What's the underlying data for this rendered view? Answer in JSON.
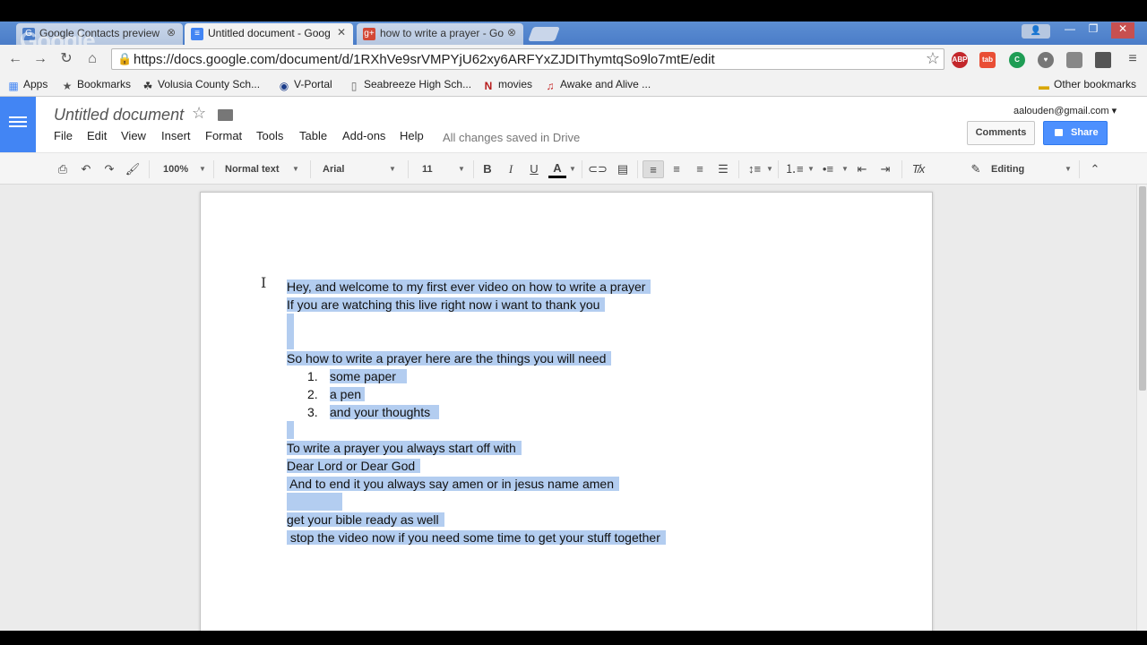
{
  "browser": {
    "tabs": [
      {
        "label": "Google Contacts preview",
        "favicon": "G"
      },
      {
        "label": "Untitled document - Goog",
        "favicon": "docs"
      },
      {
        "label": "how to write a prayer - Go",
        "favicon": "g+"
      }
    ],
    "url": "https://docs.google.com/document/d/1RXhVe9srVMPYjU62xy6ARFYxZJDIThymtqSo9lo7mtE/edit",
    "watermark": "Google",
    "extensions": [
      {
        "label": "ABP",
        "color": "#c3272b"
      },
      {
        "label": "tab",
        "color": "#e94e35"
      },
      {
        "label": "C",
        "color": "#1f9d55"
      },
      {
        "label": "♥",
        "color": "#777777"
      }
    ]
  },
  "bookmarks": {
    "apps": "Apps",
    "items": [
      "Bookmarks",
      "Volusia County Sch...",
      "V-Portal",
      "Seabreeze High Sch...",
      "movies",
      "Awake and Alive ..."
    ],
    "other": "Other bookmarks"
  },
  "docs": {
    "title": "Untitled document",
    "menu": [
      "File",
      "Edit",
      "View",
      "Insert",
      "Format",
      "Tools",
      "Table",
      "Add-ons",
      "Help"
    ],
    "saved_status": "All changes saved in Drive",
    "account": "aalouden@gmail.com",
    "comments_label": "Comments",
    "share_label": "Share",
    "accent_color": "#4285f4"
  },
  "toolbar": {
    "zoom": "100%",
    "style": "Normal text",
    "font": "Arial",
    "size": "11",
    "mode": "Editing"
  },
  "document": {
    "lines": [
      "Hey, and welcome to my first ever video on how to write a prayer",
      "If you are watching this live right now i want to thank you",
      "",
      "So how to write a prayer here are the things you will need"
    ],
    "list": [
      {
        "num": "1.",
        "text": "some paper"
      },
      {
        "num": "2.",
        "text": "a pen"
      },
      {
        "num": "3.",
        "text": "and your thoughts"
      }
    ],
    "after": [
      "To write a prayer you always start off with",
      "Dear Lord or Dear God",
      " And to end it you always say amen or in jesus name amen",
      "",
      "get your bible ready as well",
      " stop the video now if you need some time to get your stuff together"
    ],
    "selection_color": "#b3cdf0"
  }
}
